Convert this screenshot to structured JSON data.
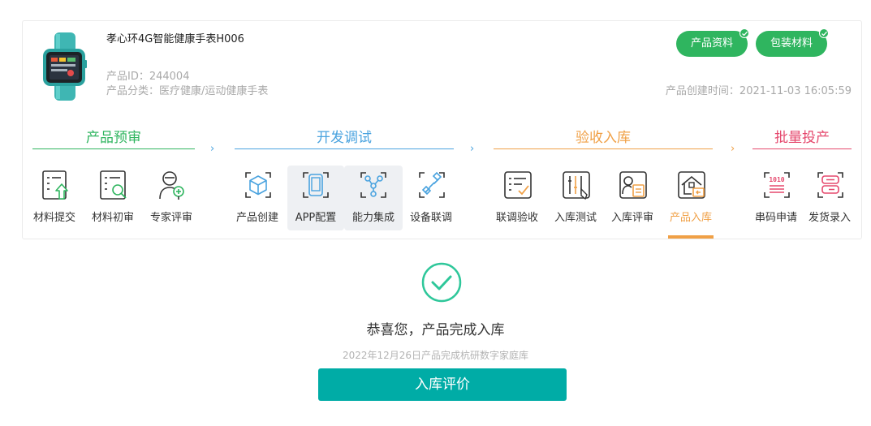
{
  "product": {
    "name": "孝心环4G智能健康手表H006",
    "id_text": "产品ID：244004",
    "category_text": "产品分类：医疗健康/运动健康手表",
    "created_text": "产品创建时间：2021-11-03 16:05:59"
  },
  "badges": [
    {
      "label": "产品资料",
      "icon": "check-icon"
    },
    {
      "label": "包装材料",
      "icon": "check-icon"
    }
  ],
  "stages": [
    {
      "title": "产品预审",
      "color": "#2fb55f",
      "steps": [
        {
          "label": "材料提交",
          "icon": "upload-doc-icon"
        },
        {
          "label": "材料初审",
          "icon": "doc-search-icon"
        },
        {
          "label": "专家评审",
          "icon": "expert-icon"
        }
      ]
    },
    {
      "title": "开发调试",
      "color": "#4aa3df",
      "steps": [
        {
          "label": "产品创建",
          "icon": "cube-icon"
        },
        {
          "label": "APP配置",
          "icon": "phone-icon"
        },
        {
          "label": "能力集成",
          "icon": "network-icon"
        },
        {
          "label": "设备联调",
          "icon": "link-icon"
        }
      ]
    },
    {
      "title": "验收入库",
      "color": "#f0a046",
      "steps": [
        {
          "label": "联调验收",
          "icon": "checklist-icon"
        },
        {
          "label": "入库测试",
          "icon": "test-icon"
        },
        {
          "label": "入库评审",
          "icon": "review-icon"
        },
        {
          "label": "产品入库",
          "icon": "warehouse-icon"
        }
      ]
    },
    {
      "title": "批量投产",
      "color": "#e5486d",
      "steps": [
        {
          "label": "串码申请",
          "icon": "code-icon"
        },
        {
          "label": "发货录入",
          "icon": "shipping-icon"
        }
      ]
    }
  ],
  "result": {
    "message": "恭喜您，产品完成入库",
    "sub": "2022年12月26日产品完成杭研数字家庭库",
    "button": "入库评价"
  }
}
